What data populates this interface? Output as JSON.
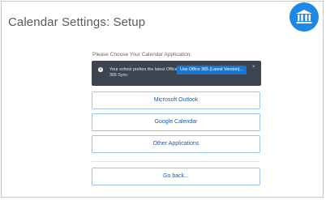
{
  "page": {
    "title": "Calendar Settings: Setup"
  },
  "logo": {
    "icon": "institution-icon",
    "color": "#1e88e5"
  },
  "setup": {
    "prompt": "Please Choose Your Calendar Application:",
    "banner": {
      "message": "Your school prefers the latest Office 365 Sync:",
      "button_label": "Use Office 365 (Latest Version)...",
      "close_label": "×"
    },
    "options": [
      {
        "label": "Microsoft Outlook"
      },
      {
        "label": "Google Calendar"
      },
      {
        "label": "Other Applications"
      }
    ],
    "back_label": "Go back..."
  },
  "colors": {
    "accent": "#1976d2",
    "banner_bg": "#3b4450",
    "option_border": "#9ec3ec",
    "option_text": "#1e5aa8"
  }
}
